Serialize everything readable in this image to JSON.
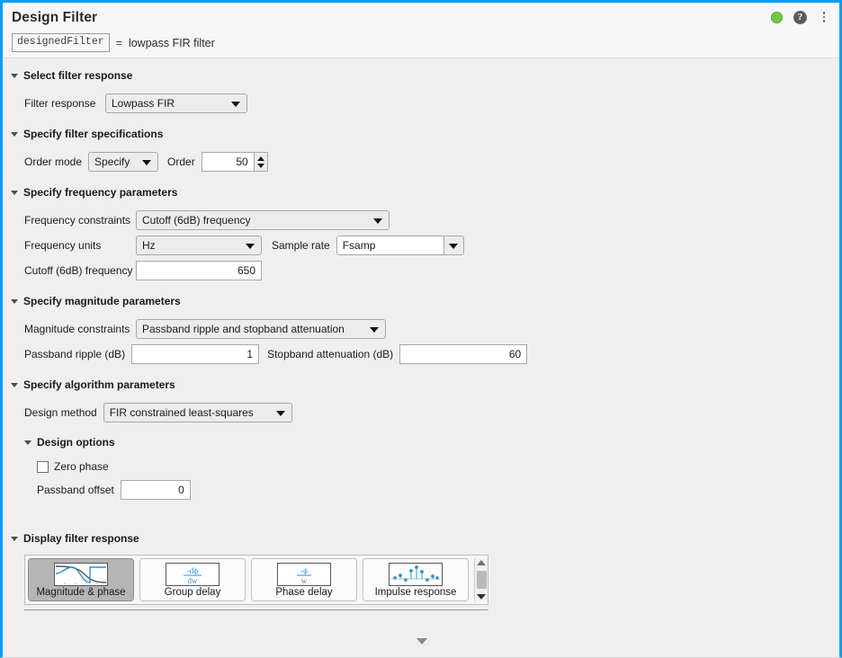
{
  "header": {
    "title": "Design Filter",
    "variable": "designedFilter",
    "equals": "=",
    "description": "lowpass FIR filter",
    "status_icon": "green-status-dot",
    "status_color": "#6ecc42",
    "help_icon": "?",
    "menu_icon": "kebab-menu-icon"
  },
  "sections": {
    "filter_response": {
      "title": "Select filter response",
      "filter_response_label": "Filter response",
      "filter_response_value": "Lowpass FIR"
    },
    "filter_specs": {
      "title": "Specify filter specifications",
      "order_mode_label": "Order mode",
      "order_mode_value": "Specify",
      "order_label": "Order",
      "order_value": "50"
    },
    "frequency": {
      "title": "Specify frequency parameters",
      "constraints_label": "Frequency constraints",
      "constraints_value": "Cutoff (6dB) frequency",
      "units_label": "Frequency units",
      "units_value": "Hz",
      "sample_rate_label": "Sample rate",
      "sample_rate_value": "Fsamp",
      "cutoff_label": "Cutoff (6dB) frequency",
      "cutoff_value": "650"
    },
    "magnitude": {
      "title": "Specify magnitude parameters",
      "constraints_label": "Magnitude constraints",
      "constraints_value": "Passband ripple and stopband attenuation",
      "passband_ripple_label": "Passband ripple (dB)",
      "passband_ripple_value": "1",
      "stopband_atten_label": "Stopband attenuation (dB)",
      "stopband_atten_value": "60"
    },
    "algorithm": {
      "title": "Specify algorithm parameters",
      "design_method_label": "Design method",
      "design_method_value": "FIR constrained least-squares",
      "design_options_title": "Design options",
      "zero_phase_label": "Zero phase",
      "zero_phase_checked": "unchecked",
      "passband_offset_label": "Passband offset",
      "passband_offset_value": "0"
    },
    "display": {
      "title": "Display filter response",
      "items": [
        {
          "label": "Magnitude & phase",
          "icon": "magnitude-phase-icon",
          "selected": true
        },
        {
          "label": "Group delay",
          "icon": "group-delay-icon",
          "selected": false
        },
        {
          "label": "Phase delay",
          "icon": "phase-delay-icon",
          "selected": false
        },
        {
          "label": "Impulse response",
          "icon": "impulse-response-icon",
          "selected": false
        }
      ],
      "group_delay_numerator": "-dϕ",
      "group_delay_denominator": "dw",
      "phase_delay_numerator": "-ϕ",
      "phase_delay_denominator": "w"
    }
  }
}
